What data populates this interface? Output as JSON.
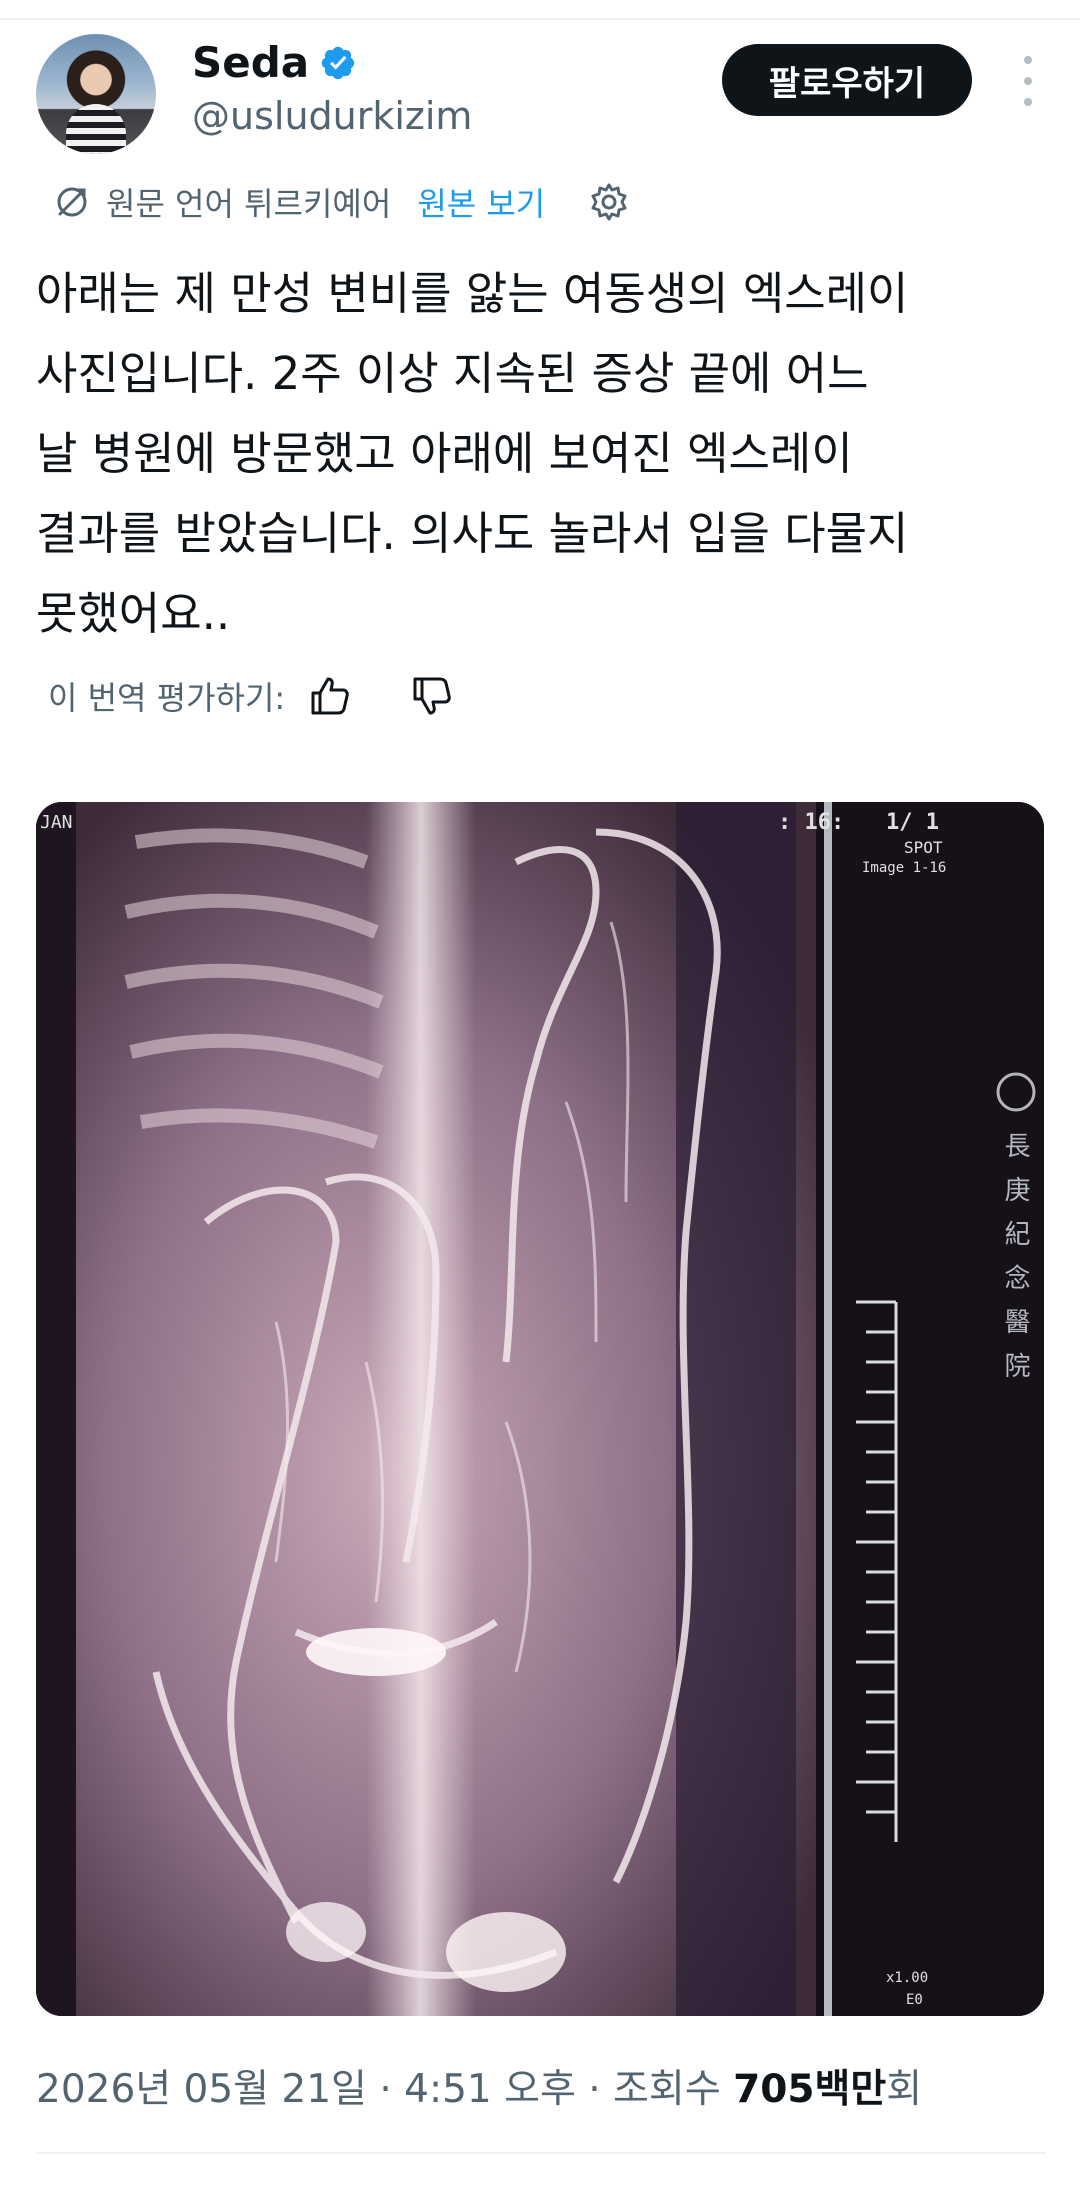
{
  "user": {
    "name": "Seda",
    "handle": "@usludurkizim",
    "verified": true,
    "verified_color": "#1d9bf0"
  },
  "header": {
    "follow_label": "팔로우하기",
    "more_icon": "more-vertical-icon"
  },
  "translation": {
    "notice": "원문 언어 튀르키예어",
    "show_original": "원본 보기",
    "rate_label": "이 번역 평가하기:"
  },
  "tweet": {
    "lines": [
      "아래는 제 만성 변비를 앓는 여동생의 엑스레이",
      "사진입니다. 2주 이상 지속된 증상 끝에 어느",
      "날 병원에 방문했고 아래에 보여진 엑스레이",
      "결과를 받았습니다. 의사도 놀라서 입을 다물지",
      "못했어요.."
    ]
  },
  "media": {
    "overlay_top_left": "JAN",
    "overlay_counter": ": 16:",
    "overlay_frame": "1/ 1",
    "overlay_spot": "SPOT",
    "overlay_image": "Image 1-16",
    "overlay_scale": "x1.00",
    "overlay_bottom": "E0",
    "hospital_vertical": "長庚紀念醫院"
  },
  "meta": {
    "datetime": "2026년 05월 21일 · 4:51 오후 · 조회수 ",
    "views": "705백만",
    "views_suffix": "회"
  },
  "colors": {
    "accent": "#1d9bf0",
    "text_primary": "#0f1419",
    "text_secondary": "#536471"
  }
}
